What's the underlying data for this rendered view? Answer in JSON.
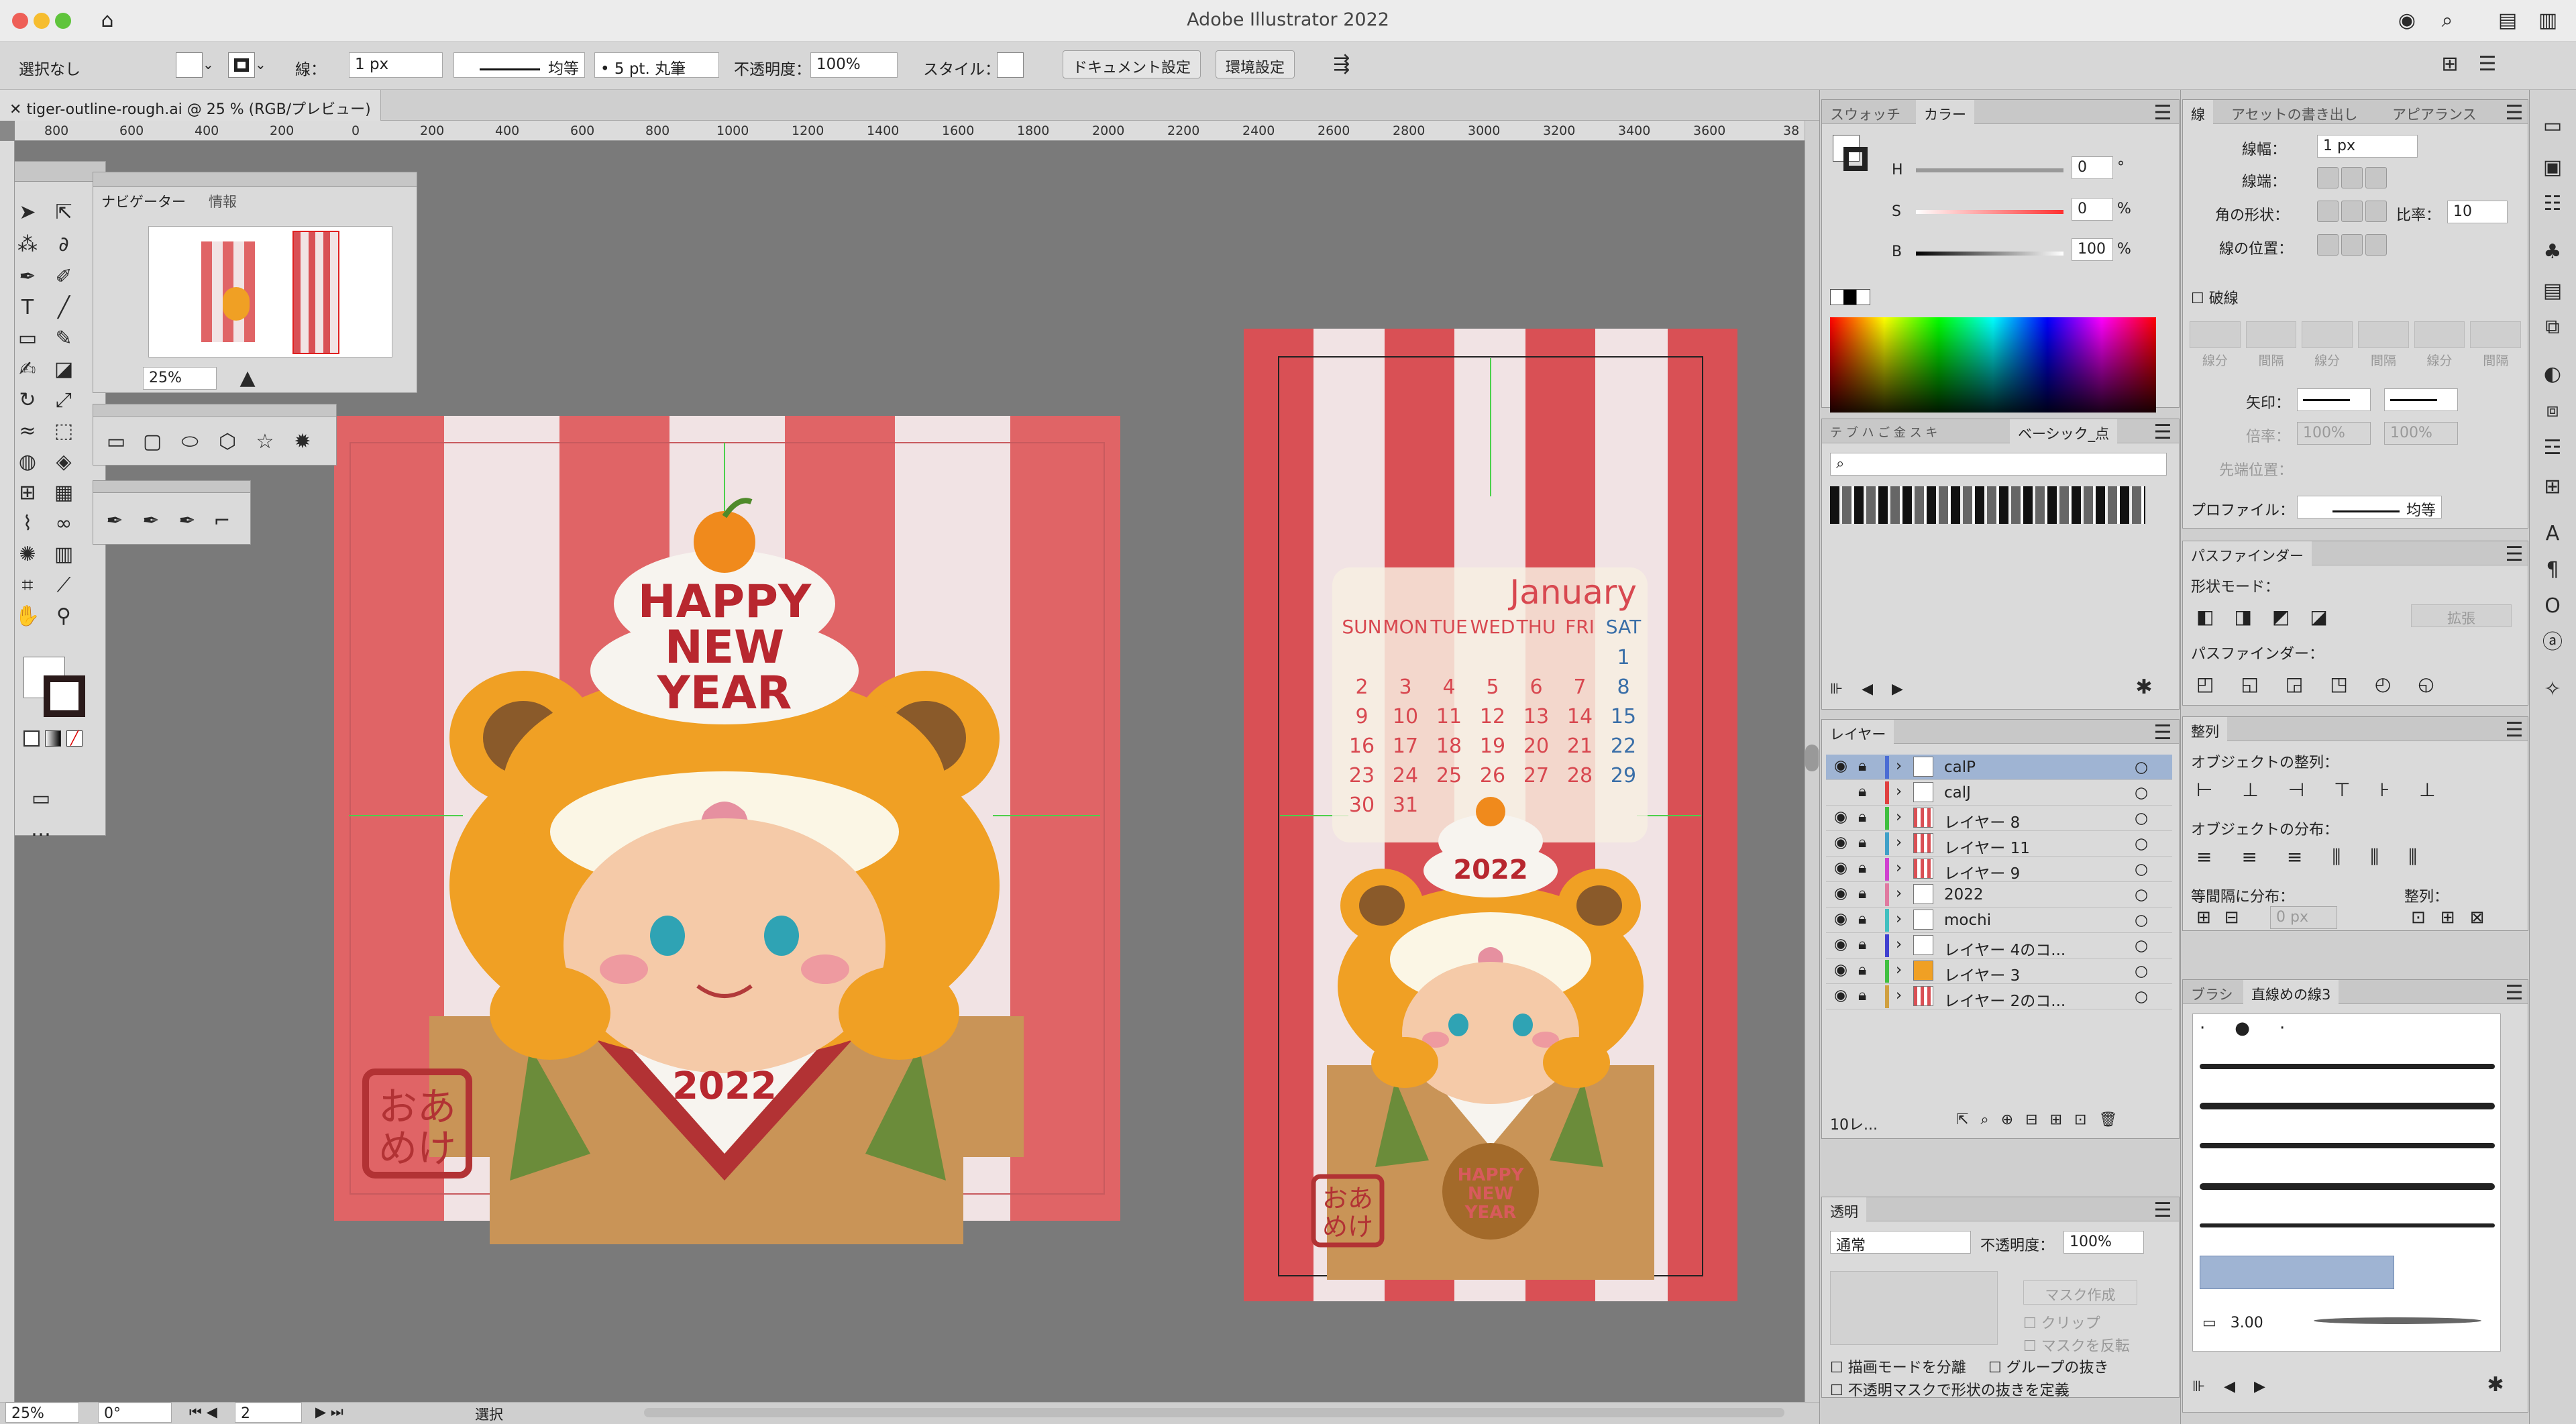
{
  "window": {
    "title": "Adobe Illustrator 2022"
  },
  "control": {
    "selection": "選択なし",
    "stroke_label": "線：",
    "stroke_weight": "1 px",
    "stroke_profile": "均等",
    "brush": "5 pt. 丸筆",
    "opacity_label": "不透明度：",
    "opacity": "100%",
    "style_label": "スタイル：",
    "doc_setup": "ドキュメント設定",
    "prefs": "環境設定"
  },
  "document": {
    "tab": "tiger-outline-rough.ai @ 25 % (RGB/プレビュー)"
  },
  "ruler": {
    "h": [
      "800",
      "600",
      "400",
      "200",
      "0",
      "200",
      "400",
      "600",
      "800",
      "1000",
      "1200",
      "1400",
      "1600",
      "1800",
      "2000",
      "2200",
      "2400",
      "2600",
      "2800",
      "3000",
      "3200",
      "3400",
      "3600",
      "38"
    ]
  },
  "navigator": {
    "tab1": "ナビゲーター",
    "tab2": "情報",
    "zoom": "25%"
  },
  "art1": {
    "title1": "HAPPY",
    "title2": "NEW",
    "title3": "YEAR",
    "year": "2022",
    "stamp1": "おあ",
    "stamp2": "めけ"
  },
  "art2": {
    "month": "January",
    "days": [
      "SUN",
      "MON",
      "TUE",
      "WED",
      "THU",
      "FRI",
      "SAT"
    ],
    "weeks": [
      [
        "",
        "",
        "",
        "",
        "",
        "",
        "1"
      ],
      [
        "2",
        "3",
        "4",
        "5",
        "6",
        "7",
        "8"
      ],
      [
        "9",
        "10",
        "11",
        "12",
        "13",
        "14",
        "15"
      ],
      [
        "16",
        "17",
        "18",
        "19",
        "20",
        "21",
        "22"
      ],
      [
        "23",
        "24",
        "25",
        "26",
        "27",
        "28",
        "29"
      ],
      [
        "30",
        "31",
        "",
        "",
        "",
        "",
        ""
      ]
    ],
    "year": "2022",
    "mochi1": "HAPPY",
    "mochi2": "NEW",
    "mochi3": "YEAR",
    "stamp1": "おあ",
    "stamp2": "めけ"
  },
  "color_panel": {
    "tab1": "スウォッチ",
    "tab2": "カラー",
    "h_label": "H",
    "h": "0",
    "s_label": "S",
    "s": "0",
    "b_label": "B",
    "b": "100",
    "deg": "°",
    "pct": "%"
  },
  "swatch_lib": {
    "tab": "ベーシック_点"
  },
  "layers_panel": {
    "tab": "レイヤー",
    "count": "10レ...",
    "rows": [
      {
        "name": "calP",
        "color": "#4a6cd4"
      },
      {
        "name": "calJ",
        "color": "#e04040"
      },
      {
        "name": "レイヤー 8",
        "color": "#3fbf3f"
      },
      {
        "name": "レイヤー 11",
        "color": "#3fa0c8"
      },
      {
        "name": "レイヤー 9",
        "color": "#d040d0"
      },
      {
        "name": "2022",
        "color": "#e07aa0"
      },
      {
        "name": "mochi",
        "color": "#40c0c0"
      },
      {
        "name": "レイヤー 4のコ...",
        "color": "#4040d0"
      },
      {
        "name": "レイヤー 3",
        "color": "#40c040"
      },
      {
        "name": "レイヤー 2のコ...",
        "color": "#d0a040"
      }
    ]
  },
  "transparency": {
    "tab": "透明",
    "mode": "通常",
    "opacity_label": "不透明度：",
    "opacity": "100%",
    "mask_btn": "マスク作成",
    "clip": "クリップ",
    "invert": "マスクを反転",
    "isolate": "描画モードを分離",
    "knockout": "グループの抜き",
    "shape": "不透明マスクで形状の抜きを定義"
  },
  "stroke_panel": {
    "tab1": "線",
    "tab2": "アセットの書き出し",
    "tab3": "アピアランス",
    "weight_label": "線幅：",
    "weight": "1 px",
    "cap_label": "線端：",
    "corner_label": "角の形状：",
    "limit_label": "比率：",
    "limit": "10",
    "align_label": "線の位置：",
    "dashed": "破線",
    "dash_labels": [
      "線分",
      "間隔",
      "線分",
      "間隔",
      "線分",
      "間隔"
    ],
    "arrow_label": "矢印：",
    "scale_label": "倍率：",
    "scale1": "100%",
    "scale2": "100%",
    "tip_label": "先端位置：",
    "profile_label": "プロファイル：",
    "profile": "均等"
  },
  "pathfinder": {
    "tab": "パスファインダー",
    "shape_modes": "形状モード：",
    "expand": "拡張",
    "pathfinders": "パスファインダー："
  },
  "align": {
    "tab": "整列",
    "objects": "オブジェクトの整列：",
    "distribute": "オブジェクトの分布：",
    "spacing": "等間隔に分布：",
    "align_to": "整列：",
    "spacing_val": "0 px"
  },
  "brushes": {
    "tab1": "ブラシ",
    "tab2": "直線めの線3",
    "size": "3.00"
  },
  "status": {
    "zoom": "25%",
    "angle": "0°",
    "artboard": "2",
    "tool": "選択"
  },
  "colors": {
    "red": "#e06466",
    "pink": "#f1e3e4",
    "orange": "#f0a024",
    "brown": "#8a5a2a",
    "cal_red": "#d84850",
    "cal_blue": "#3a6fa8"
  }
}
